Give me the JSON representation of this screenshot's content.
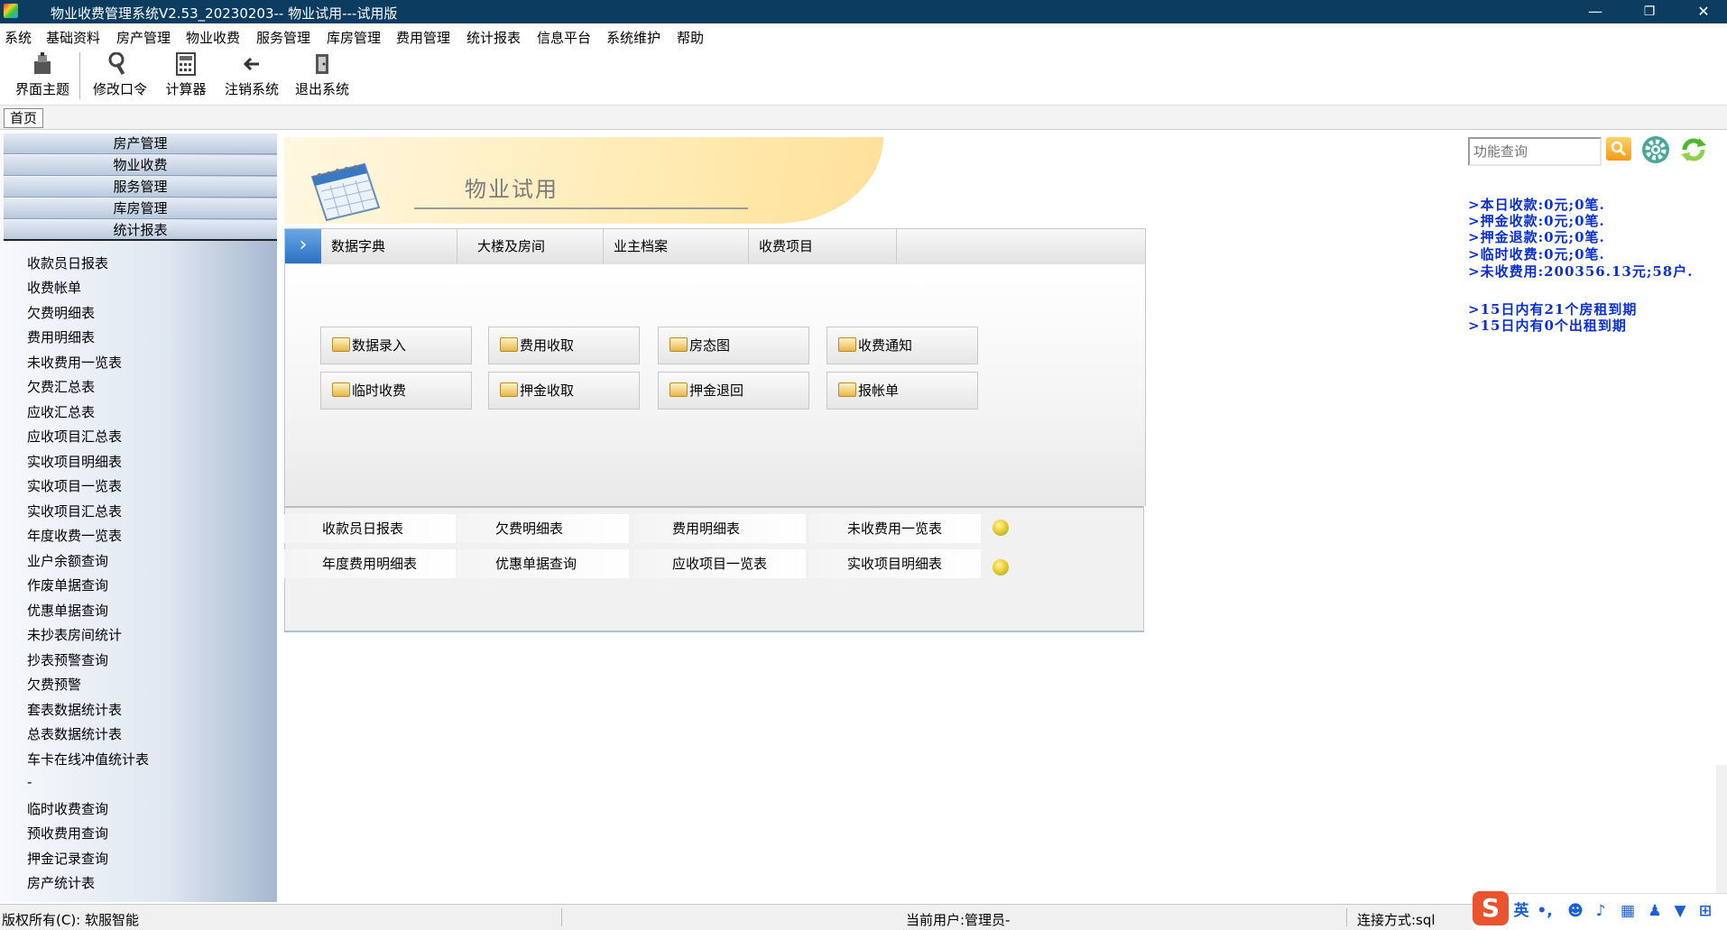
{
  "window": {
    "title": "物业收费管理系统V2.53_20230203--      物业试用---试用版",
    "minimize": "—",
    "restore": "❐",
    "close": "✕"
  },
  "menu": [
    "系统",
    "基础资料",
    "房产管理",
    "物业收费",
    "服务管理",
    "库房管理",
    "费用管理",
    "统计报表",
    "信息平台",
    "系统维护",
    "帮助"
  ],
  "toolbar": [
    {
      "label": "界面主题",
      "icon": "theme-icon"
    },
    {
      "label": "修改口令",
      "icon": "key-icon"
    },
    {
      "label": "计算器",
      "icon": "calculator-icon"
    },
    {
      "label": "注销系统",
      "icon": "logout-arrow-icon"
    },
    {
      "label": "退出系统",
      "icon": "exit-door-icon"
    }
  ],
  "tabs": {
    "home": "首页"
  },
  "sidebar": {
    "groups": [
      "房产管理",
      "物业收费",
      "服务管理",
      "库房管理",
      "统计报表"
    ],
    "items": [
      "收款员日报表",
      "收费帐单",
      "欠费明细表",
      "费用明细表",
      "未收费用一览表",
      "欠费汇总表",
      "应收汇总表",
      "应收项目汇总表",
      "实收项目明细表",
      "实收项目一览表",
      "实收项目汇总表",
      "年度收费一览表",
      "业户余额查询",
      "作废单据查询",
      "优惠单据查询",
      "未抄表房间统计",
      "抄表预警查询",
      "欠费预警",
      "套表数据统计表",
      "总表数据统计表",
      "车卡在线冲值统计表",
      "-",
      "临时收费查询",
      "预收费用查询",
      "押金记录查询",
      "房产统计表"
    ]
  },
  "main": {
    "banner_title": "物业试用",
    "tab_arrow": "›",
    "nav_tabs": [
      "数据字典",
      "大楼及房间",
      "业主档案",
      "收费项目"
    ],
    "func_buttons": [
      "数据录入",
      "费用收取",
      "房态图",
      "收费通知",
      "临时收费",
      "押金收取",
      "押金退回",
      "报帐单"
    ],
    "reports": [
      "收款员日报表",
      "欠费明细表",
      "费用明细表",
      "未收费用一览表",
      "年度费用明细表",
      "优惠单据查询",
      "应收项目一览表",
      "实收项目明细表"
    ]
  },
  "right": {
    "search_placeholder": "功能查询",
    "info": [
      ">本日收款:0元;0笔.",
      ">押金收款:0元;0笔.",
      ">押金退款:0元;0笔.",
      ">临时收费:0元;0笔.",
      ">未收费用:200356.13元;58户.",
      ">15日内有21个房租到期",
      ">15日内有0个出租到期"
    ],
    "info_color": "#0a2fd0"
  },
  "status": {
    "copyright": "版权所有(C):  软服智能",
    "user": "当前用户:管理员-",
    "connection": "连接方式:sql"
  },
  "ime": {
    "logo": "S",
    "lang": "英"
  }
}
